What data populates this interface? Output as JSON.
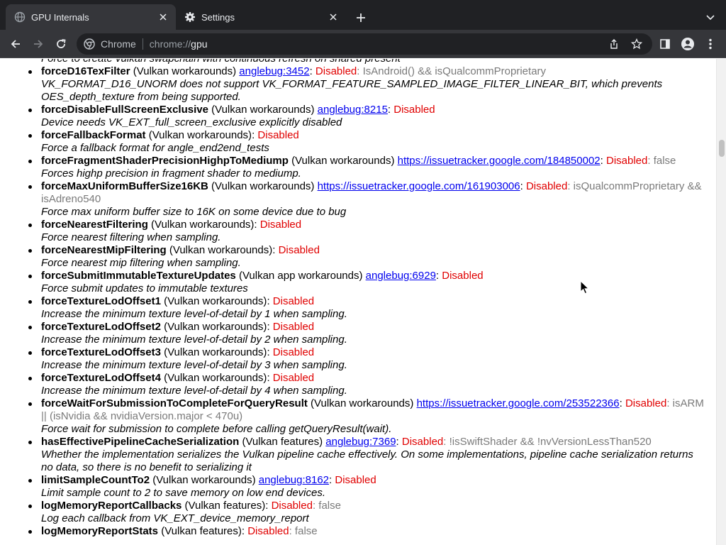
{
  "browser": {
    "tabs": [
      {
        "title": "GPU Internals",
        "icon": "globe-icon",
        "active": true
      },
      {
        "title": "Settings",
        "icon": "gear-icon",
        "active": false
      }
    ],
    "omnibox": {
      "chip": "Chrome",
      "url_scheme": "chrome://",
      "url_host": "gpu"
    }
  },
  "colors": {
    "status": "#e00000",
    "condition": "#7a7a7a",
    "link": "#0000ee"
  },
  "features": [
    {
      "desc": "Force to create vulkan swapchain with continuous refresh on shared present"
    },
    {
      "name": "forceD16TexFilter",
      "category": " (Vulkan workarounds) ",
      "link": "anglebug:3452",
      "status": "Disabled",
      "condition": ": IsAndroid() && isQualcommProprietary",
      "desc": "VK_FORMAT_D16_UNORM does not support VK_FORMAT_FEATURE_SAMPLED_IMAGE_FILTER_LINEAR_BIT, which prevents OES_depth_texture from being supported."
    },
    {
      "name": "forceDisableFullScreenExclusive",
      "category": " (Vulkan workarounds) ",
      "link": "anglebug:8215",
      "status": "Disabled",
      "desc": "Device needs VK_EXT_full_screen_exclusive explicitly disabled"
    },
    {
      "name": "forceFallbackFormat",
      "category": " (Vulkan workarounds)",
      "status": "Disabled",
      "desc": "Force a fallback format for angle_end2end_tests"
    },
    {
      "name": "forceFragmentShaderPrecisionHighpToMediump",
      "category": " (Vulkan workarounds) ",
      "link": "https://issuetracker.google.com/184850002",
      "status": "Disabled",
      "condition": ": false",
      "desc": "Forces highp precision in fragment shader to mediump."
    },
    {
      "name": "forceMaxUniformBufferSize16KB",
      "category": " (Vulkan workarounds) ",
      "link": "https://issuetracker.google.com/161903006",
      "status": "Disabled",
      "condition": ": isQualcommProprietary && isAdreno540",
      "desc": "Force max uniform buffer size to 16K on some device due to bug"
    },
    {
      "name": "forceNearestFiltering",
      "category": " (Vulkan workarounds)",
      "status": "Disabled",
      "desc": "Force nearest filtering when sampling."
    },
    {
      "name": "forceNearestMipFiltering",
      "category": " (Vulkan workarounds)",
      "status": "Disabled",
      "desc": "Force nearest mip filtering when sampling."
    },
    {
      "name": "forceSubmitImmutableTextureUpdates",
      "category": " (Vulkan app workarounds) ",
      "link": "anglebug:6929",
      "status": "Disabled",
      "desc": "Force submit updates to immutable textures"
    },
    {
      "name": "forceTextureLodOffset1",
      "category": " (Vulkan workarounds)",
      "status": "Disabled",
      "desc": "Increase the minimum texture level-of-detail by 1 when sampling."
    },
    {
      "name": "forceTextureLodOffset2",
      "category": " (Vulkan workarounds)",
      "status": "Disabled",
      "desc": "Increase the minimum texture level-of-detail by 2 when sampling."
    },
    {
      "name": "forceTextureLodOffset3",
      "category": " (Vulkan workarounds)",
      "status": "Disabled",
      "desc": "Increase the minimum texture level-of-detail by 3 when sampling."
    },
    {
      "name": "forceTextureLodOffset4",
      "category": " (Vulkan workarounds)",
      "status": "Disabled",
      "desc": "Increase the minimum texture level-of-detail by 4 when sampling."
    },
    {
      "name": "forceWaitForSubmissionToCompleteForQueryResult",
      "category": " (Vulkan workarounds) ",
      "link": "https://issuetracker.google.com/253522366",
      "status": "Disabled",
      "condition": ": isARM || (isNvidia && nvidiaVersion.major < 470u)",
      "desc": "Force wait for submission to complete before calling getQueryResult(wait)."
    },
    {
      "name": "hasEffectivePipelineCacheSerialization",
      "category": " (Vulkan features) ",
      "link": "anglebug:7369",
      "status": "Disabled",
      "condition": ": !isSwiftShader && !nvVersionLessThan520",
      "desc": "Whether the implementation serializes the Vulkan pipeline cache effectively. On some implementations, pipeline cache serialization returns no data, so there is no benefit to serializing it"
    },
    {
      "name": "limitSampleCountTo2",
      "category": " (Vulkan workarounds) ",
      "link": "anglebug:8162",
      "status": "Disabled",
      "desc": "Limit sample count to 2 to save memory on low end devices."
    },
    {
      "name": "logMemoryReportCallbacks",
      "category": " (Vulkan features)",
      "status": "Disabled",
      "condition": ": false",
      "desc": "Log each callback from VK_EXT_device_memory_report"
    },
    {
      "name": "logMemoryReportStats",
      "category": " (Vulkan features)",
      "status": "Disabled",
      "condition": ": false",
      "desc": ""
    }
  ]
}
